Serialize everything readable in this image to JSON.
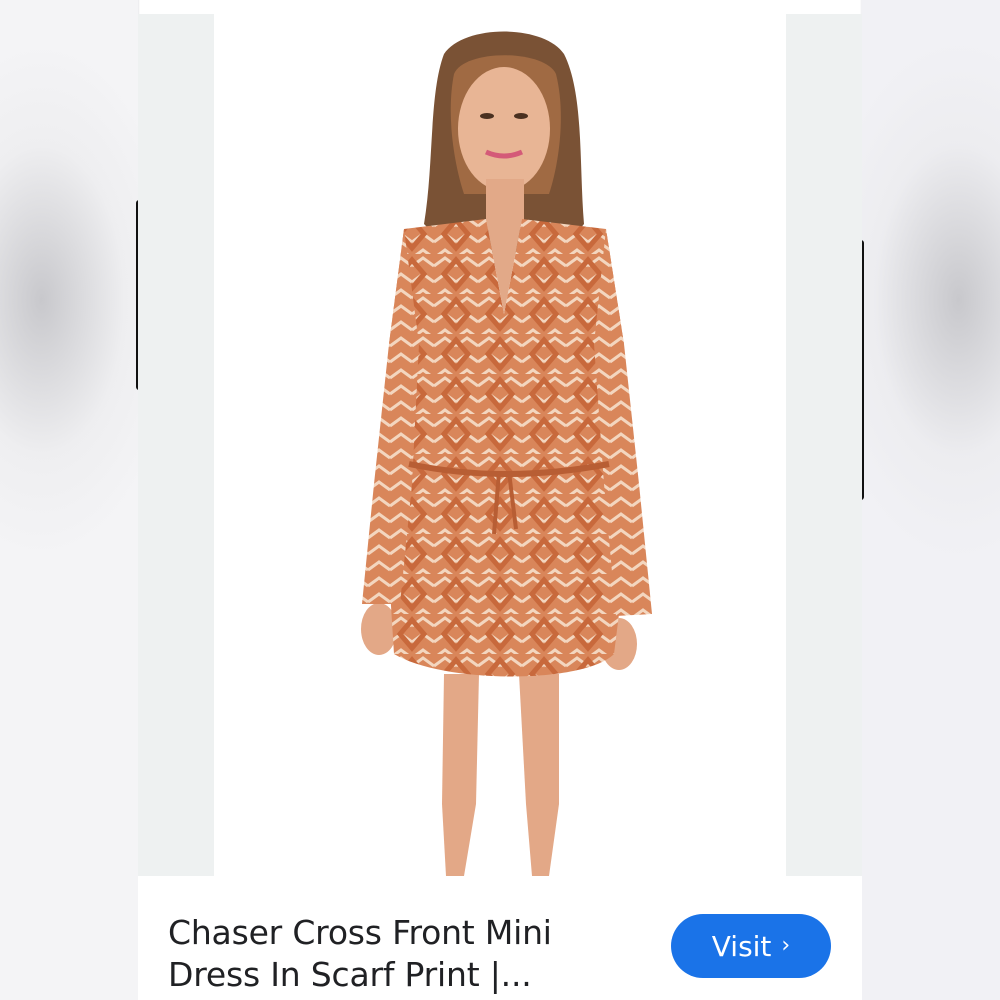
{
  "result": {
    "title": "Chaser Cross Front Mini Dress In Scarf Print |...",
    "visit_label": "Visit",
    "visit_chevron": "›"
  },
  "colors": {
    "button": "#1a73e8",
    "dress": "#d9865a",
    "dress_pattern": "#f3d6bf"
  },
  "icons": {
    "visit": "chevron-right-icon"
  }
}
